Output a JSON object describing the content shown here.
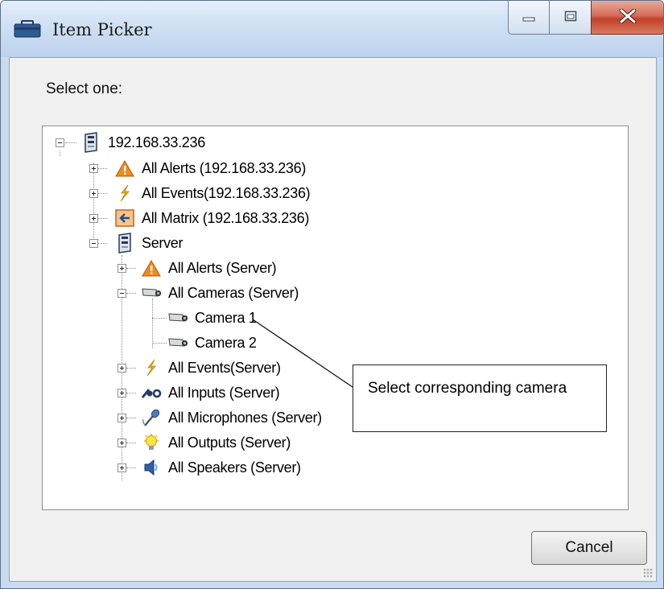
{
  "window": {
    "title": "Item Picker",
    "controls": {
      "minimize": "minimize",
      "maximize": "maximize",
      "close": "close"
    }
  },
  "dialog": {
    "prompt": "Select one:",
    "cancel_label": "Cancel"
  },
  "tree": {
    "nodes": [
      {
        "label": "192.168.33.236",
        "icon": "server-icon",
        "expanded": true
      },
      {
        "label": "All Alerts (192.168.33.236)",
        "icon": "alert-icon",
        "expanded": false
      },
      {
        "label": "All Events(192.168.33.236)",
        "icon": "lightning-icon",
        "expanded": false
      },
      {
        "label": "All Matrix (192.168.33.236)",
        "icon": "matrix-icon",
        "expanded": false
      },
      {
        "label": "Server",
        "icon": "server-icon",
        "expanded": true
      },
      {
        "label": "All Alerts (Server)",
        "icon": "alert-icon",
        "expanded": false
      },
      {
        "label": "All Cameras (Server)",
        "icon": "camera-icon",
        "expanded": true
      },
      {
        "label": "Camera 1",
        "icon": "camera-icon"
      },
      {
        "label": "Camera 2",
        "icon": "camera-icon"
      },
      {
        "label": "All Events(Server)",
        "icon": "lightning-icon",
        "expanded": false
      },
      {
        "label": "All Inputs (Server)",
        "icon": "input-icon",
        "expanded": false
      },
      {
        "label": "All Microphones (Server)",
        "icon": "microphone-icon",
        "expanded": false
      },
      {
        "label": "All Outputs (Server)",
        "icon": "bulb-icon",
        "expanded": false
      },
      {
        "label": "All Speakers (Server)",
        "icon": "speaker-icon",
        "expanded": false
      }
    ]
  },
  "annotation": {
    "text": "Select corresponding camera"
  },
  "colors": {
    "titlebar": "#cfe0f3",
    "close_button": "#c9452d",
    "alert": "#f08a1a",
    "lightning": "#f2b01e"
  }
}
